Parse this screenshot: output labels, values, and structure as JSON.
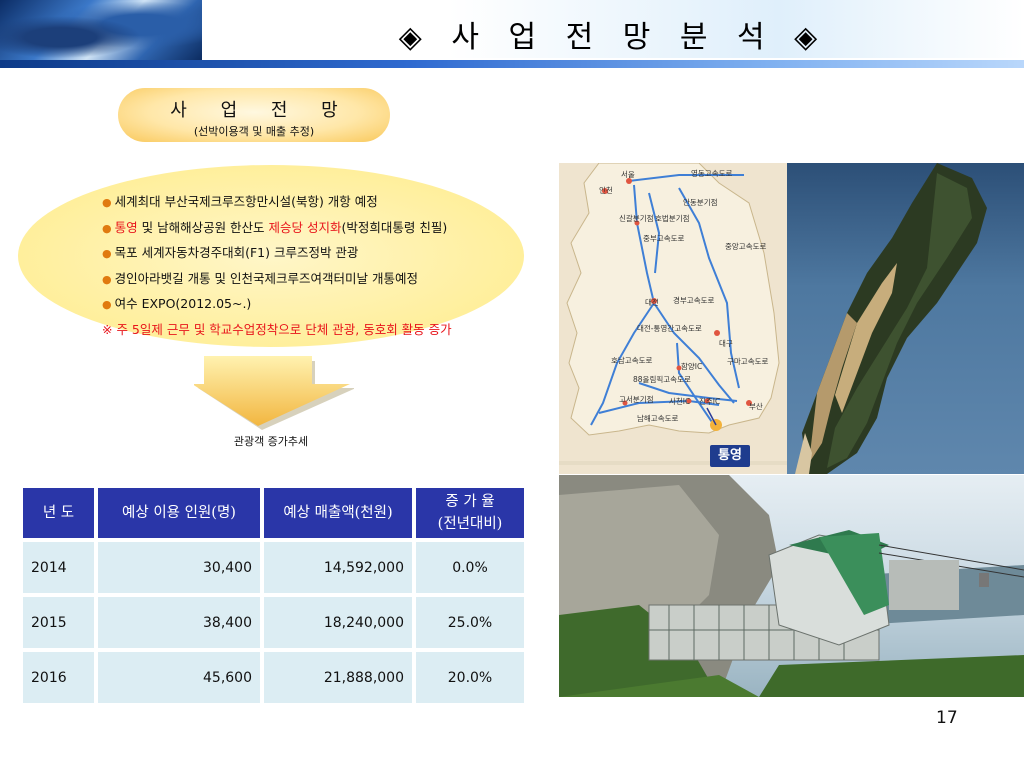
{
  "header": {
    "title": "◈ 사 업 전 망 분 석 ◈"
  },
  "section": {
    "title": "사 업 전 망",
    "subtitle": "(선박이용객 및 매출 추정)"
  },
  "bullets": [
    {
      "parts": [
        {
          "text": "세계최대 부산국제크루즈항만시설(북항) 개항 예정",
          "highlight": false
        }
      ]
    },
    {
      "parts": [
        {
          "text": "통영",
          "highlight": true
        },
        {
          "text": " 및 남해해상공원 한산도 ",
          "highlight": false
        },
        {
          "text": "제승당 성지화",
          "highlight": true
        },
        {
          "text": "(박정희대통령 친필)",
          "highlight": false
        }
      ]
    },
    {
      "parts": [
        {
          "text": "목포 세계자동차경주대회(F1) 크루즈정박 관광",
          "highlight": false
        }
      ]
    },
    {
      "parts": [
        {
          "text": "경인아라뱃길 개통 및 인천국제크루즈여객터미날 개통예정",
          "highlight": false
        }
      ]
    },
    {
      "parts": [
        {
          "text": "여수 EXPO(2012.05~.)",
          "highlight": false
        }
      ]
    }
  ],
  "note": "※ 주 5일제 근무 및 학교수업정착으로 단체 관광, 동호회 활동 증가",
  "arrow_caption": "관광객 증가추세",
  "table": {
    "headers": [
      "년 도",
      "예상 이용 인원(명)",
      "예상 매출액(천원)",
      "증 가 율",
      "(전년대비)"
    ],
    "rows": [
      {
        "year": "2014",
        "visitors": "30,400",
        "revenue": "14,592,000",
        "rate": "0.0%"
      },
      {
        "year": "2015",
        "visitors": "38,400",
        "revenue": "18,240,000",
        "rate": "25.0%"
      },
      {
        "year": "2016",
        "visitors": "45,600",
        "revenue": "21,888,000",
        "rate": "20.0%"
      }
    ]
  },
  "map": {
    "labels": [
      "서울",
      "영동고속도로",
      "인천",
      "안동분기점",
      "신갈분기점",
      "호법분기점",
      "중부고속도로",
      "중앙고속도로",
      "대전",
      "경부고속도로",
      "대전-통영간고속도로",
      "대구",
      "호남고속도로",
      "함양IC",
      "구마고속도로",
      "88올림픽고속도로",
      "고서분기점",
      "사천IC",
      "진주IC",
      "부산",
      "남해고속도로"
    ],
    "badge": "통영"
  },
  "page_number": "17"
}
